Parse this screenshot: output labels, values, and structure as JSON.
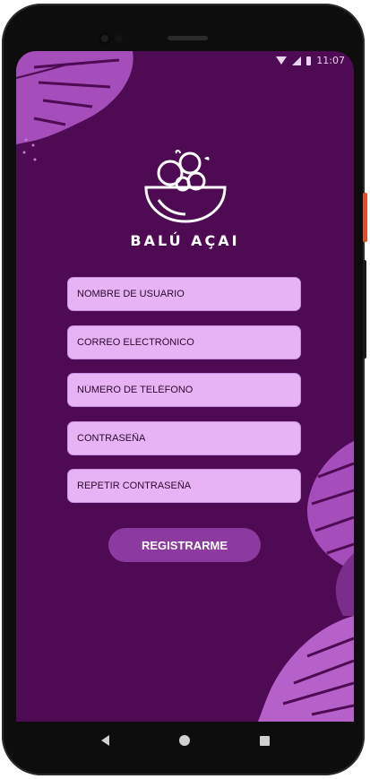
{
  "status": {
    "time": "11:07"
  },
  "brand": {
    "name": "BALÚ AÇAI"
  },
  "form": {
    "username_placeholder": "NOMBRE DE USUARIO",
    "email_placeholder": "CORREO ELECTRÓNICO",
    "phone_placeholder": "NÚMERO DE TELÉFONO",
    "password_placeholder": "CONTRASEÑA",
    "repeat_password_placeholder": "REPETIR CONTRASEÑA",
    "register_label": "REGISTRARME"
  },
  "colors": {
    "background": "#4e0b53",
    "field": "#e7b3f5",
    "button": "#8c3a9f",
    "leaf": "#a44dbb"
  }
}
